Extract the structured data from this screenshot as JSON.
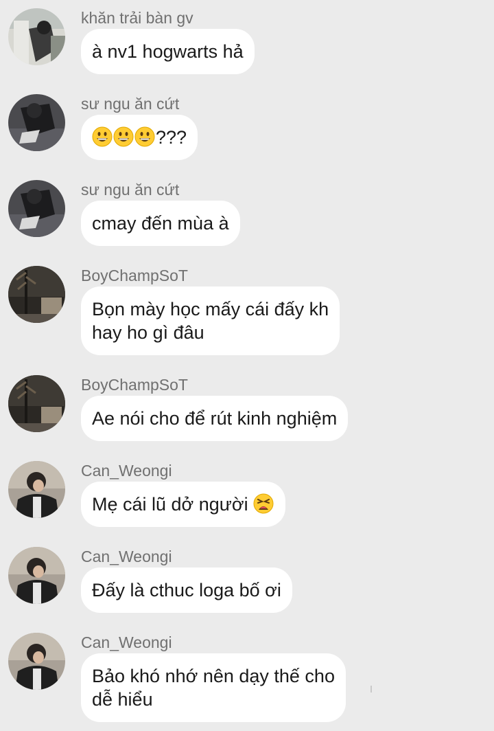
{
  "messages": [
    {
      "sender": "khăn trải bàn gv",
      "lines": [
        "à nv1 hogwarts hả"
      ],
      "avatar": "avatar-khan-trai-ban-gv"
    },
    {
      "sender": "sư ngu ăn cứt",
      "emojis": [
        "grinning-face-emoji",
        "grinning-face-emoji",
        "grinning-face-emoji"
      ],
      "text_after_emoji": "???",
      "avatar": "avatar-su-ngu-an-cut"
    },
    {
      "sender": "sư ngu ăn cứt",
      "lines": [
        "cmay đến mùa à"
      ],
      "avatar": "avatar-su-ngu-an-cut"
    },
    {
      "sender": "BoyChampSoT",
      "lines": [
        "Bọn mày học mấy cái đấy kh",
        "hay ho gì đâu"
      ],
      "avatar": "avatar-boychampsot"
    },
    {
      "sender": "BoyChampSoT",
      "lines": [
        "Ae nói cho để rút kinh nghiệm"
      ],
      "avatar": "avatar-boychampsot"
    },
    {
      "sender": "Can_Weongi",
      "text_before_emoji": "Mẹ cái lũ dở người ",
      "emoji_after": "tired-face-emoji",
      "avatar": "avatar-can-weongi"
    },
    {
      "sender": "Can_Weongi",
      "lines": [
        "Đấy là cthuc loga bố ơi"
      ],
      "avatar": "avatar-can-weongi"
    },
    {
      "sender": "Can_Weongi",
      "lines": [
        "Bảo khó nhớ nên dạy thế cho",
        "dễ hiểu"
      ],
      "avatar": "avatar-can-weongi"
    }
  ],
  "colors": {
    "background": "#ebebeb",
    "bubble": "#ffffff",
    "sender_text": "#707070",
    "message_text": "#1a1a1a",
    "emoji_yellow": "#ffcc33"
  }
}
